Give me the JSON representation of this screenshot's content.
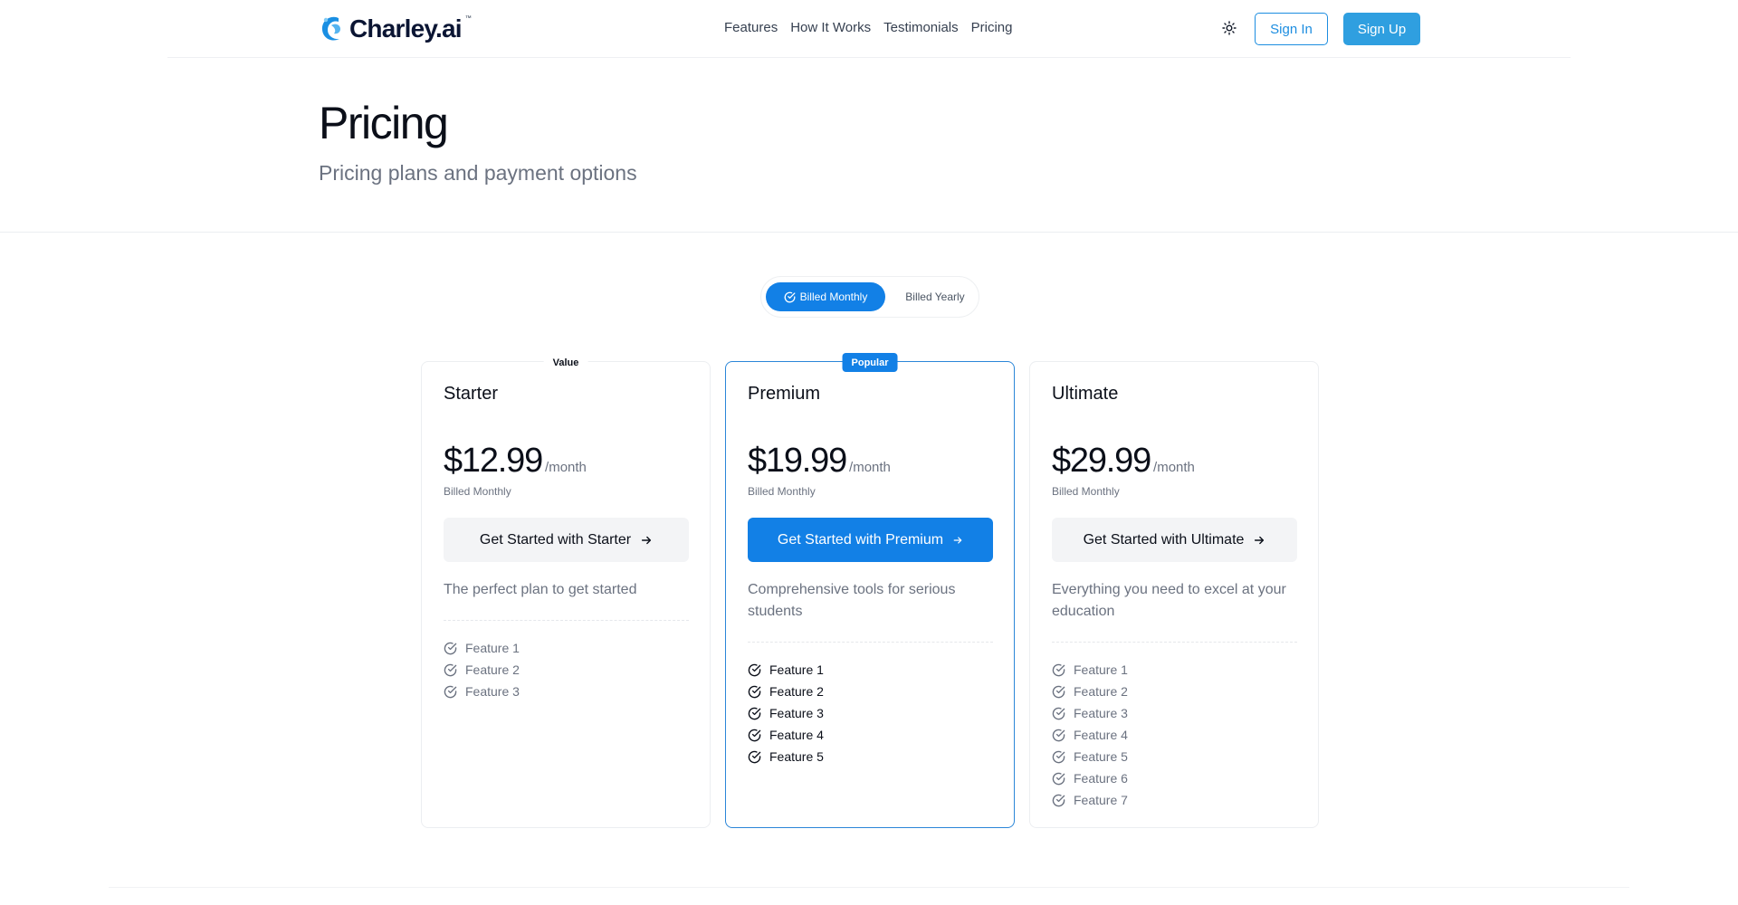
{
  "brand": {
    "name_main": "Charley",
    "name_suffix": ".ai",
    "trademark": "™"
  },
  "nav": {
    "items": [
      {
        "label": "Features"
      },
      {
        "label": "How It Works"
      },
      {
        "label": "Testimonials"
      },
      {
        "label": "Pricing"
      }
    ]
  },
  "header": {
    "theme_icon": "sun-icon",
    "sign_in_label": "Sign In",
    "sign_up_label": "Sign Up"
  },
  "hero": {
    "title": "Pricing",
    "subtitle": "Pricing plans and payment options"
  },
  "billing_toggle": {
    "active_label": "Billed Monthly",
    "inactive_label": "Billed Yearly"
  },
  "plans": [
    {
      "badge": "Value",
      "name": "Starter",
      "price": "$12.99",
      "period": "/month",
      "billed": "Billed Monthly",
      "cta": "Get Started with Starter",
      "description": "The perfect plan to get started",
      "features": [
        "Feature 1",
        "Feature 2",
        "Feature 3"
      ]
    },
    {
      "badge": "Popular",
      "name": "Premium",
      "price": "$19.99",
      "period": "/month",
      "billed": "Billed Monthly",
      "cta": "Get Started with Premium",
      "description": "Comprehensive tools for serious students",
      "features": [
        "Feature 1",
        "Feature 2",
        "Feature 3",
        "Feature 4",
        "Feature 5"
      ]
    },
    {
      "badge": "",
      "name": "Ultimate",
      "price": "$29.99",
      "period": "/month",
      "billed": "Billed Monthly",
      "cta": "Get Started with Ultimate",
      "description": "Everything you need to excel at your education",
      "features": [
        "Feature 1",
        "Feature 2",
        "Feature 3",
        "Feature 4",
        "Feature 5",
        "Feature 6",
        "Feature 7"
      ]
    }
  ],
  "colors": {
    "accent": "#1280e6",
    "sign_up_bg": "#2f9fe0",
    "sign_in_border": "#1c8de0",
    "muted_text": "#6b7280"
  }
}
